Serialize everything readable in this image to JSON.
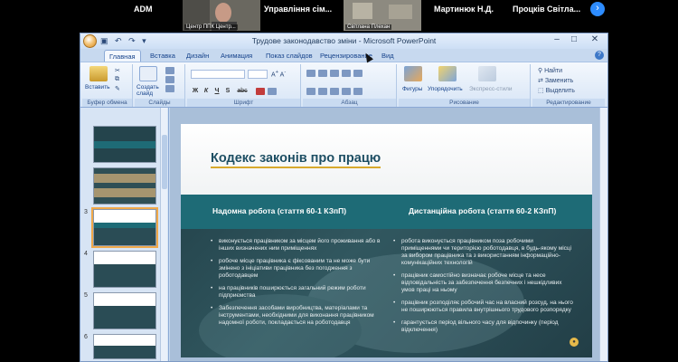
{
  "participants": {
    "tiles": [
      {
        "name": "ADM"
      },
      {
        "name": "",
        "caption": "Центр ППК Центр..."
      },
      {
        "name": "Управління сім..."
      },
      {
        "name": "",
        "caption": "Світлана Плехан"
      },
      {
        "name": "Мартинюк Н.Д."
      },
      {
        "name": "Процків Світла..."
      }
    ],
    "next_icon": "chevron-right"
  },
  "window": {
    "title": "Трудове законодавство зміни - Microsoft PowerPoint",
    "quick_access": [
      "save",
      "undo",
      "redo"
    ],
    "controls": [
      "minimize",
      "maximize",
      "close"
    ]
  },
  "ribbon": {
    "tabs": [
      "Главная",
      "Вставка",
      "Дизайн",
      "Анимация",
      "Показ слайдов",
      "Рецензирование",
      "Вид"
    ],
    "active_tab": "Главная",
    "groups": {
      "clipboard": {
        "label": "Буфер обмена",
        "paste": "Вставить"
      },
      "slides": {
        "label": "Слайды",
        "new_slide": "Создать слайд"
      },
      "font": {
        "label": "Шрифт"
      },
      "paragraph": {
        "label": "Абзац"
      },
      "drawing": {
        "label": "Рисование",
        "shapes": "Фигуры",
        "arrange": "Упорядочить",
        "quick_styles": "Экспресс-стили"
      },
      "editing": {
        "label": "Редактирование",
        "find": "Найти",
        "replace": "Заменить",
        "select": "Выделить"
      }
    },
    "format_buttons": [
      "Ж",
      "К",
      "Ч",
      "S",
      "abc"
    ]
  },
  "thumbnails": {
    "numbers": [
      "",
      "",
      "3",
      "4",
      "5",
      "6"
    ],
    "selected": 3
  },
  "slide": {
    "title": "Кодекс законів про працю",
    "left": {
      "heading": "Надомна робота (стаття 60-1 КЗпП)",
      "bullets": [
        "виконується працівником за місцем його проживання або в інших визначених ним приміщеннях",
        "робоче місце працівника є фіксованим та не може бути змінено з ініціативи працівника без погодження з роботодавцем",
        "на працівників поширюється загальний режим роботи підприємства",
        "Забезпечення засобами виробництва, матеріалами та інструментами, необхідними для виконання працівником надомної роботи, покладається на роботодавця"
      ]
    },
    "right": {
      "heading": "Дистанційна робота (стаття 60-2 КЗпП)",
      "bullets": [
        "робота виконується працівником поза робочими приміщеннями чи територією роботодавця, в будь-якому місці за вибором працівника та з використанням інформаційно-комунікаційних технологій",
        "працівник самостійно визначає робоче місце та несе відповідальність за забезпечення безпечних і нешкідливих умов праці на ньому",
        "працівник розподіляє робочий час на власний розсуд, на нього не поширюються правила внутрішнього трудового розпорядку",
        "гарантується період вільного часу для відпочинку (період відключення)"
      ]
    },
    "colors": {
      "title": "#1d4e63",
      "accent": "#d8a92d",
      "header_band": "#1e6b76",
      "body_bg": "#2a4c55"
    }
  }
}
